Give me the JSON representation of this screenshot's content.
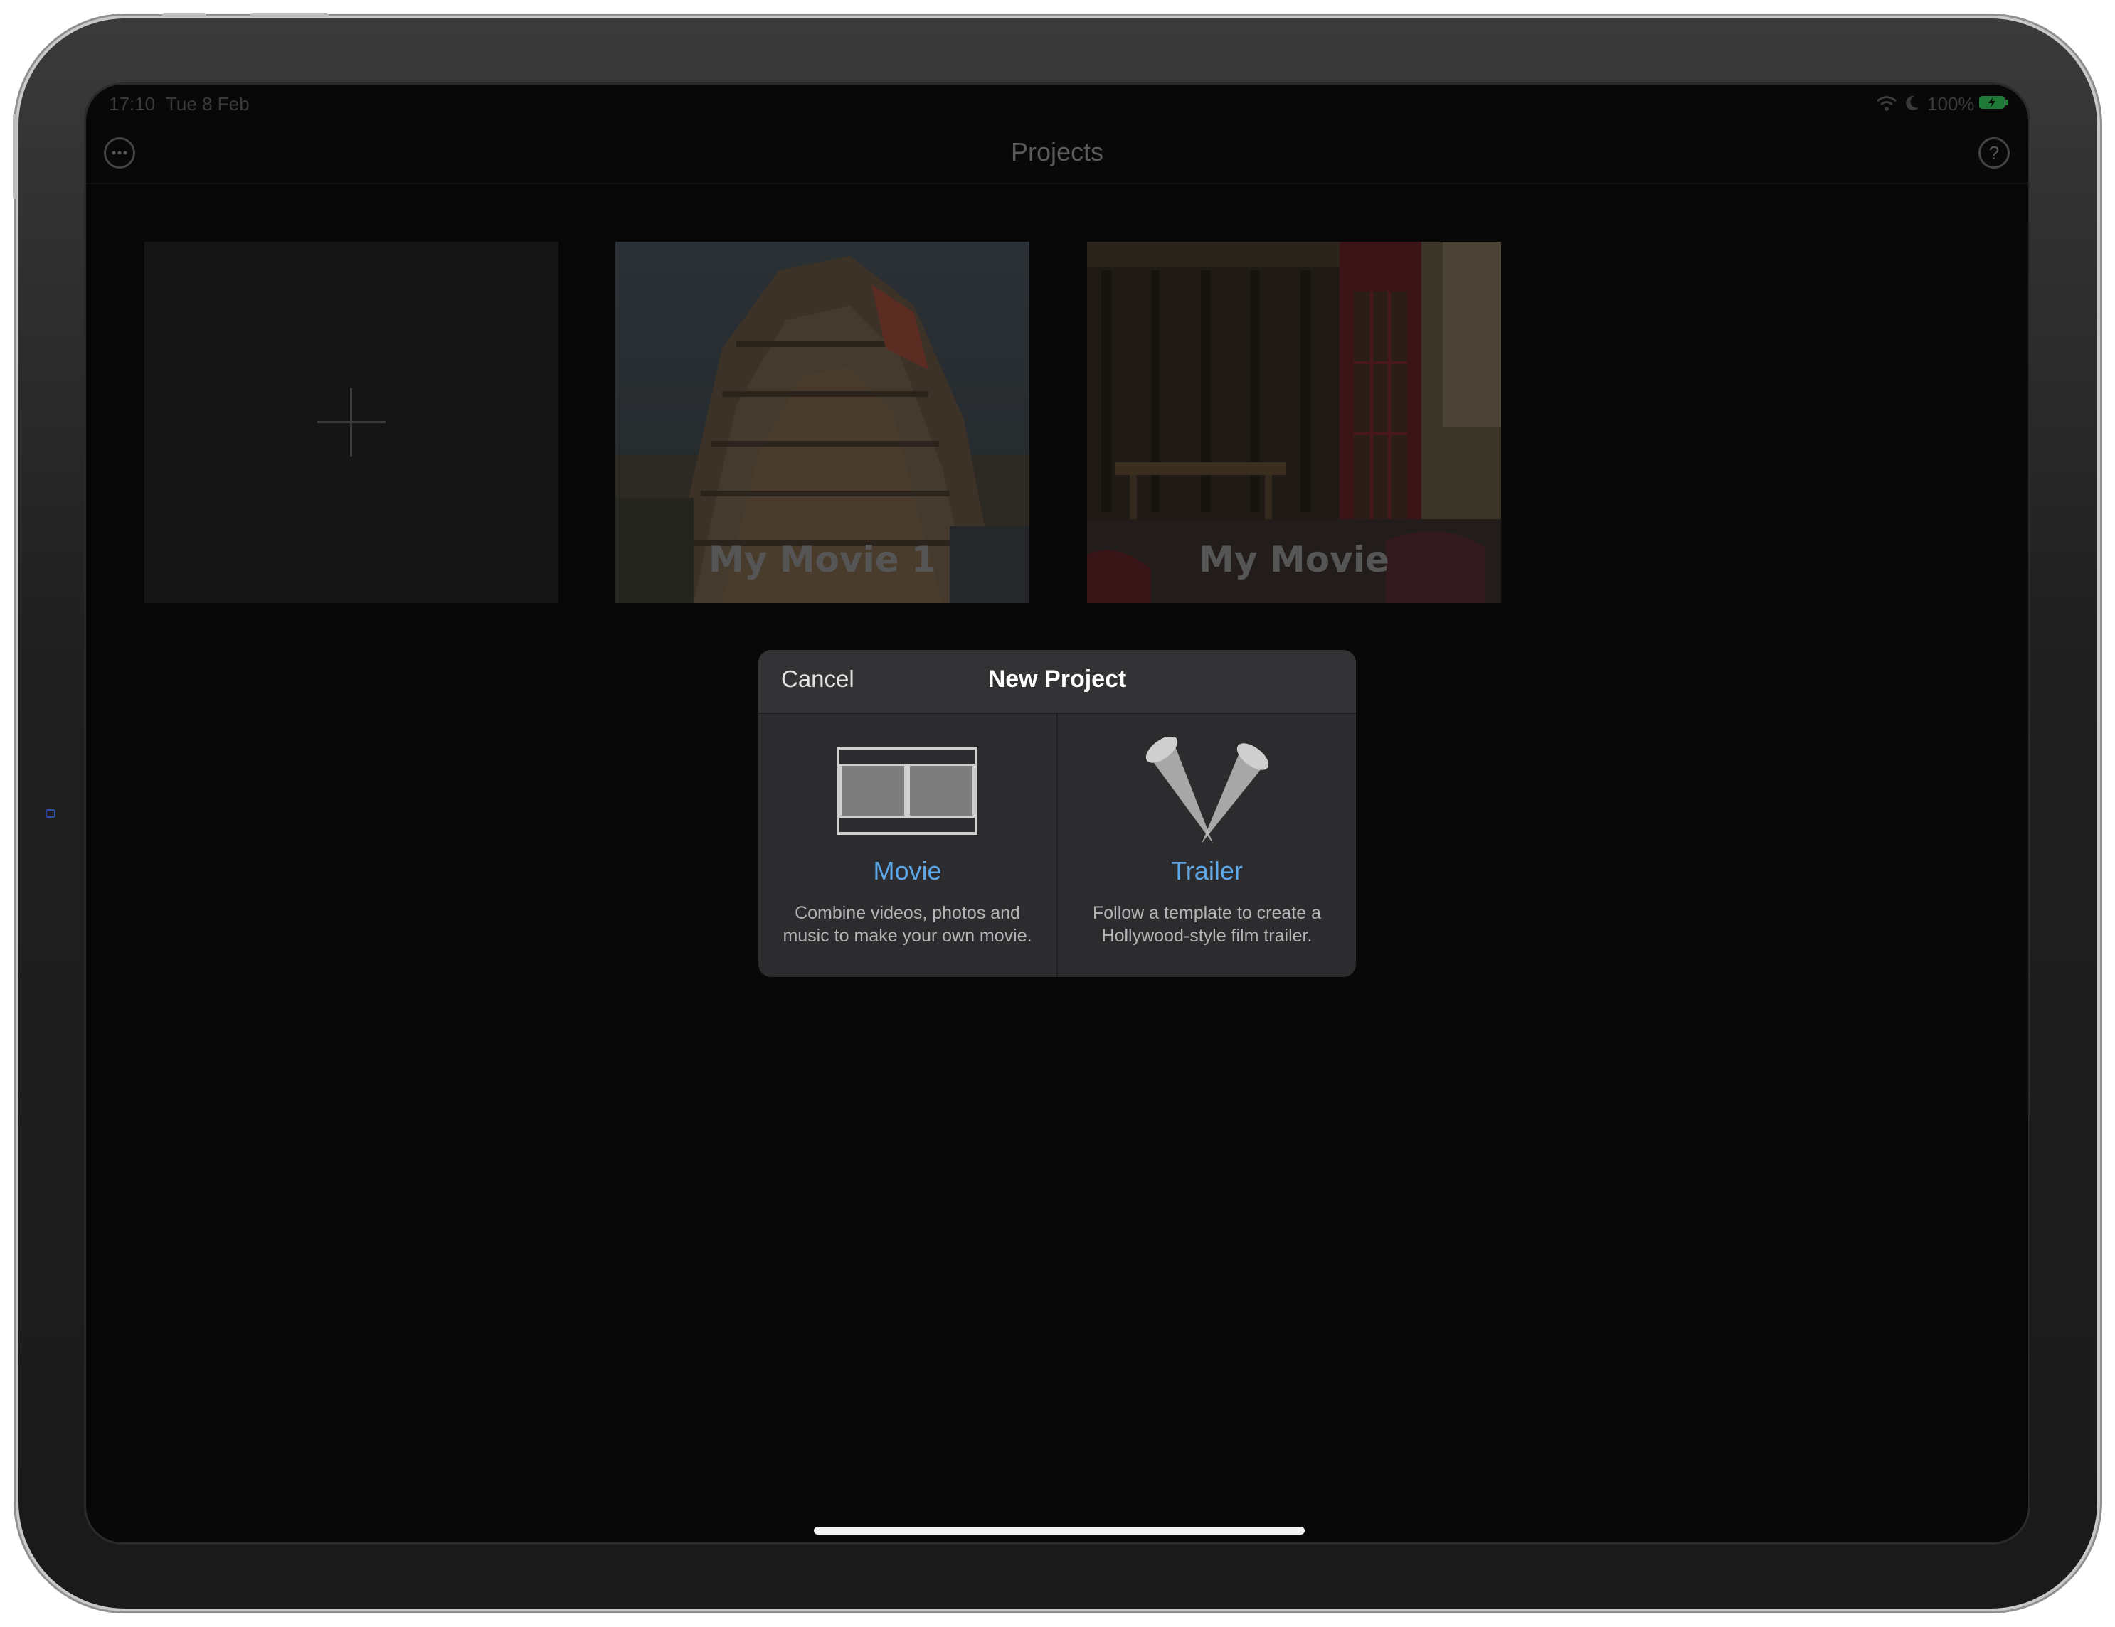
{
  "status_bar": {
    "time": "17:10",
    "date": "Tue 8 Feb",
    "battery": "100%"
  },
  "nav": {
    "title": "Projects",
    "more_icon": "ellipsis-icon",
    "help_glyph": "?"
  },
  "projects": {
    "new_tile": {
      "icon": "plus-icon"
    },
    "tiles": [
      {
        "title": "My Movie 1"
      },
      {
        "title": "My Movie"
      }
    ]
  },
  "new_project_dialog": {
    "title": "New Project",
    "cancel_label": "Cancel",
    "options": [
      {
        "label": "Movie",
        "desc_line1": "Combine videos, photos and",
        "desc_line2": "music to make your own movie.",
        "icon": "film-strip-icon"
      },
      {
        "label": "Trailer",
        "desc_line1": "Follow a template to create a",
        "desc_line2": "Hollywood-style film trailer.",
        "icon": "spotlights-icon"
      }
    ]
  },
  "colors": {
    "accent": "#5ea7e8",
    "battery_green": "#34c759"
  }
}
